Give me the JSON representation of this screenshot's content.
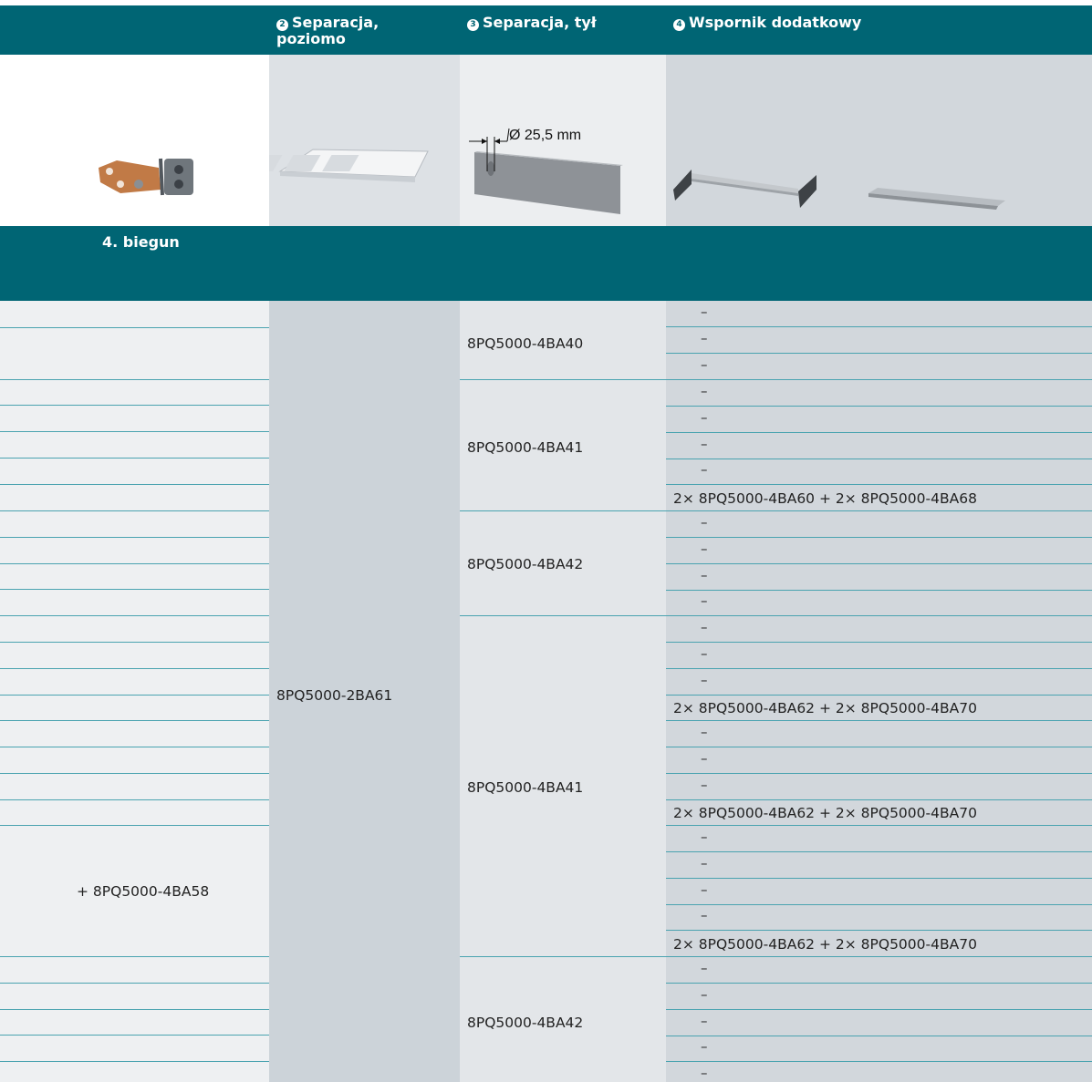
{
  "header": {
    "col2": {
      "num": "2",
      "label": "Separacja,\npoziomo"
    },
    "col3": {
      "num": "3",
      "label": "Separacja, tył"
    },
    "col4": {
      "num": "4",
      "label": "Wspornik dodatkowy"
    }
  },
  "images": {
    "col3_dim": "Ø 25,5 mm"
  },
  "band_label": "4. biegun",
  "col1": {
    "plus_part": "+   8PQ5000-4BA58"
  },
  "col2": {
    "part": "8PQ5000-2BA61"
  },
  "col3": {
    "parts": [
      "8PQ5000-4BA40",
      "8PQ5000-4BA41",
      "8PQ5000-4BA42",
      "8PQ5000-4BA41",
      "8PQ5000-4BA42"
    ]
  },
  "col4": {
    "rows": [
      "–",
      "–",
      "–",
      "–",
      "–",
      "–",
      "–",
      "2×  8PQ5000-4BA60    +   2×  8PQ5000-4BA68",
      "–",
      "–",
      "–",
      "–",
      "–",
      "–",
      "–",
      "2×  8PQ5000-4BA62    +   2×  8PQ5000-4BA70",
      "–",
      "–",
      "–",
      "2×  8PQ5000-4BA62    +   2×  8PQ5000-4BA70",
      "–",
      "–",
      "–",
      "–",
      "2×  8PQ5000-4BA62    +   2×  8PQ5000-4BA70",
      "–",
      "–",
      "–",
      "–",
      "–"
    ]
  }
}
